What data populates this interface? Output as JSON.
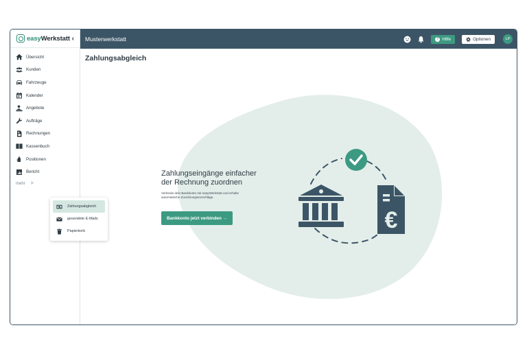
{
  "brand": {
    "prefix": "easy",
    "suffix": "Werkstatt"
  },
  "sidebar": {
    "collapse_icon": "chevron-left-icon",
    "items": [
      {
        "label": "Übersicht",
        "icon": "home-icon"
      },
      {
        "label": "Kunden",
        "icon": "users-icon"
      },
      {
        "label": "Fahrzeuge",
        "icon": "car-icon"
      },
      {
        "label": "Kalender",
        "icon": "calendar-icon"
      },
      {
        "label": "Angebote",
        "icon": "person-desk-icon"
      },
      {
        "label": "Aufträge",
        "icon": "wrench-icon"
      },
      {
        "label": "Rechnungen",
        "icon": "invoice-icon"
      },
      {
        "label": "Kassenbuch",
        "icon": "book-icon"
      },
      {
        "label": "Positionen",
        "icon": "oil-can-icon"
      },
      {
        "label": "Bericht",
        "icon": "report-icon"
      }
    ],
    "more_label": "mehr",
    "more_chevron": ">"
  },
  "topbar": {
    "title": "Musterwerkstatt",
    "help_label": "Hilfe",
    "options_label": "Optionen",
    "avatar_initials": "LP"
  },
  "main": {
    "page_title": "Zahlungsabgleich",
    "heading_line1": "Zahlungseingänge einfacher",
    "heading_line2": "der Rechnung zuordnen",
    "text_line1": "Verbinde dein Bankkonto mit easyWerkstatt und erhalte",
    "text_line2": "automatische Zuordnungsvorschläge.",
    "cta_label": "Bankkonto jetzt verbinden →"
  },
  "popup": {
    "items": [
      {
        "label": "Zahlungsabgleich",
        "icon": "money-icon",
        "active": true
      },
      {
        "label": "gesendete E-Mails",
        "icon": "mail-icon",
        "active": false
      },
      {
        "label": "Papierkorb",
        "icon": "trash-icon",
        "active": false
      }
    ]
  },
  "colors": {
    "topbar": "#3c5566",
    "accent": "#3d9a82",
    "blob": "#e3eeea",
    "illustration": "#3c5566"
  }
}
